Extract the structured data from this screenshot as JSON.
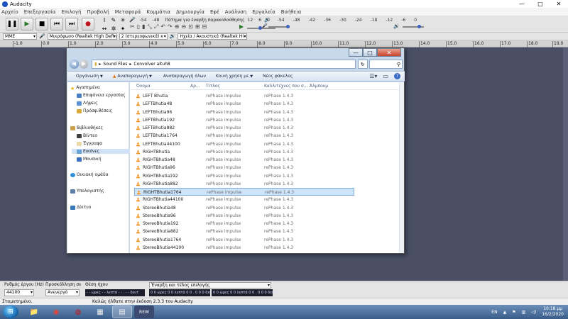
{
  "audacity": {
    "title": "Audacity",
    "window_controls": {
      "minimize": "—",
      "maximize": "□",
      "close": "✕"
    },
    "menu": [
      "Αρχείο",
      "Επεξεργασία",
      "Επιλογή",
      "Προβολή",
      "Μεταφορά",
      "Κομμάτια",
      "Δημιουργία",
      "Εφέ",
      "Ανάλυση",
      "Εργαλεία",
      "Βοήθεια"
    ],
    "transport": {
      "pause": "❚❚",
      "play": "▶",
      "stop": "■",
      "skip_start": "⏮",
      "skip_end": "⏭",
      "record": "●"
    },
    "tools": [
      "I",
      "✎",
      "✳",
      "↔",
      "✲",
      "✦"
    ],
    "meter": {
      "record_message": "Πάτημα για έναρξη παρακολούθησης",
      "record_ticks": [
        "-54",
        "-48"
      ],
      "record_ticks_after": [
        "12",
        "6",
        "0"
      ],
      "play_ticks": [
        "-54",
        "-48",
        "-42",
        "-36",
        "-30",
        "-24",
        "-18",
        "-12",
        "-6",
        "0"
      ]
    },
    "edit_tools": [
      "✂",
      "▯",
      "▮",
      "⤡",
      "⤢",
      "↶",
      "↷",
      "⊕",
      "⊖",
      "⊡",
      "⊞",
      "⊟"
    ],
    "devices": {
      "host": "MME",
      "mic_icon": "🎤",
      "input": "Μικρόφωνο (Realtek High Definit",
      "channels": "2 (στερεοφωνικά) κ",
      "speaker_icon": "🔊",
      "output": "Ηχεία / Ακουστικά (Realtek High"
    },
    "ruler": [
      "-1.0",
      "0.0",
      "1.0",
      "2.0",
      "3.0",
      "4.0",
      "5.0",
      "6.0",
      "7.0",
      "8.0",
      "9.0",
      "10.0",
      "11.0",
      "12.0",
      "13.0",
      "14.0",
      "15.0",
      "16.0",
      "17.0",
      "18.0",
      "19.0"
    ],
    "selection_bar": {
      "rate_label": "Ρυθμός έργου (Hz)",
      "rate_value": "44100",
      "snap_label": "Προσκόλληση σε",
      "snap_value": "Ανενεργό",
      "position_label": "Θέση ήχου",
      "position_value": "- - ώρες - - λεπτά - - . - - δευτ",
      "selection_label": "Έναρξη και τέλος επιλογής",
      "start_value": "0 0 ώρες 0 0 λεπτά 0 0 . 0 0 0 δευτ",
      "end_value": "0 0 ώρες 0 0 λεπτά 0 0 . 0 0 0 δευτ"
    },
    "status": {
      "left": "Σταματημένο.",
      "right": "Καλώς ήλθατε στην έκδοση 2.3.3 του Audacity"
    }
  },
  "explorer": {
    "window_controls": {
      "minimize": "—",
      "maximize": "□",
      "close": "✕"
    },
    "breadcrumb": [
      "Sound Files",
      "Convolver aituh8"
    ],
    "search_icon": "⚲",
    "commands": [
      "Οργάνωση",
      "Αναπαραγωγή",
      "Αναπαραγωγή όλων",
      "Κοινή χρήση με",
      "Νέος φάκελος"
    ],
    "nav": {
      "favorites": "Αγαπημένα",
      "desktop": "Επιφάνεια εργασίας",
      "downloads": "Λήψεις",
      "recent": "Πρόσφ.θέσεις",
      "libraries": "Βιβλιοθήκες",
      "videos": "Βίντεο",
      "documents": "Έγγραφα",
      "pictures": "Εικόνες",
      "music": "Μουσική",
      "homegroup": "Οικιακή ομάδα",
      "computer": "Υπολογιστής",
      "network": "Δίκτυο"
    },
    "columns": [
      "Όνομα",
      "Αρ...",
      "Τίτλος",
      "Καλλιτέχνες που σ...",
      "Άλμπουμ"
    ],
    "files": [
      {
        "name": "LEFT Bhutia",
        "title": "rePhase impulse",
        "artist": "rePhase 1.4.3"
      },
      {
        "name": "LEFTBhutia48",
        "title": "rePhase impulse",
        "artist": "rePhase 1.4.3"
      },
      {
        "name": "LEFTBhutia96",
        "title": "rePhase impulse",
        "artist": "rePhase 1.4.3"
      },
      {
        "name": "LEFTBhutia192",
        "title": "rePhase impulse",
        "artist": "rePhase 1.4.3"
      },
      {
        "name": "LEFTBhutia882",
        "title": "rePhase impulse",
        "artist": "rePhase 1.4.3"
      },
      {
        "name": "LEFTBhutia1764",
        "title": "rePhase impulse",
        "artist": "rePhase 1.4.3"
      },
      {
        "name": "LEFTBhutia44100",
        "title": "rePhase impulse",
        "artist": "rePhase 1.4.3"
      },
      {
        "name": "RIGHTBhutia",
        "title": "rePhase impulse",
        "artist": "rePhase 1.4.3"
      },
      {
        "name": "RIGHTBhutia48",
        "title": "rePhase impulse",
        "artist": "rePhase 1.4.3"
      },
      {
        "name": "RIGHTBhutia96",
        "title": "rePhase impulse",
        "artist": "rePhase 1.4.3"
      },
      {
        "name": "RIGHTBhutia192",
        "title": "rePhase impulse",
        "artist": "rePhase 1.4.3"
      },
      {
        "name": "RIGHTBhutia882",
        "title": "rePhase impulse",
        "artist": "rePhase 1.4.3"
      },
      {
        "name": "RIGHTBhutia1764",
        "title": "rePhase impulse",
        "artist": "rePhase 1.4.3"
      },
      {
        "name": "RIGHTBhutia44100",
        "title": "rePhase impulse",
        "artist": "rePhase 1.4.3"
      },
      {
        "name": "StereoBhutia48",
        "title": "rePhase impulse",
        "artist": "rePhase 1.4.3"
      },
      {
        "name": "StereoBhutia96",
        "title": "rePhase impulse",
        "artist": "rePhase 1.4.3"
      },
      {
        "name": "StereoBhutia192",
        "title": "rePhase impulse",
        "artist": "rePhase 1.4.3"
      },
      {
        "name": "StereoBhutia882",
        "title": "rePhase impulse",
        "artist": "rePhase 1.4.3"
      },
      {
        "name": "StereoBhutia1764",
        "title": "rePhase impulse",
        "artist": "rePhase 1.4.3"
      },
      {
        "name": "StereoBhutia44100",
        "title": "rePhase impulse",
        "artist": "rePhase 1.4.3"
      }
    ],
    "selected_file": "RIGHTBhutia1764"
  },
  "taskbar": {
    "start": "⊞",
    "apps": [
      "📁",
      "◉",
      "◍",
      "▦",
      "▤",
      "REW"
    ],
    "language": "EN",
    "time": "10:18 μμ",
    "date": "16/2/2020"
  },
  "colors": {
    "track_bg": "#4a4f66",
    "record_red": "#c0141e",
    "selection_blue": "#cde4fb",
    "vlc_orange": "#f28a12"
  }
}
